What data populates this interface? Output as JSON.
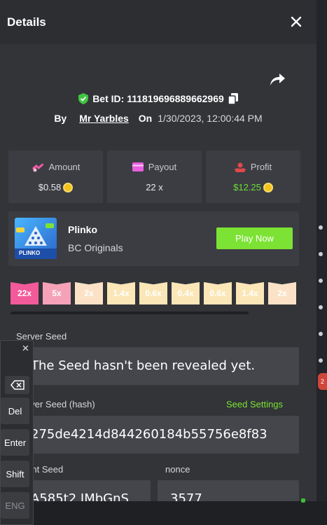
{
  "modal": {
    "title": "Details",
    "bet_id": "Bet ID: 111819696889662969",
    "by_label": "By",
    "username": "Mr Yarbles",
    "on_label": "On",
    "datetime": "1/30/2023, 12:00:44 PM"
  },
  "stats": [
    {
      "label": "Amount",
      "value": "$0.58",
      "icon": "money-icon"
    },
    {
      "label": "Payout",
      "value": "22 x",
      "icon": "card-icon"
    },
    {
      "label": "Profit",
      "value": "$12.25",
      "icon": "profit-icon"
    }
  ],
  "game": {
    "name": "Plinko",
    "provider": "BC Originals",
    "play_label": "Play Now",
    "thumb_text": "PLINKO"
  },
  "multipliers": [
    {
      "label": "22x",
      "color": "#f25a9a"
    },
    {
      "label": "5x",
      "color": "#f5a1b8"
    },
    {
      "label": "2x",
      "color": "#fbe2c6"
    },
    {
      "label": "1.4x",
      "color": "#fbe6b7"
    },
    {
      "label": "0.6x",
      "color": "#fbe6b7"
    },
    {
      "label": "0.4x",
      "color": "#fbe6b7"
    },
    {
      "label": "0.6x",
      "color": "#fbe6b7"
    },
    {
      "label": "1.4x",
      "color": "#fbe6b7"
    },
    {
      "label": "2x",
      "color": "#fbe2c6"
    },
    {
      "label": "5x",
      "color": "#f5a1b8"
    }
  ],
  "fields": {
    "server_seed_label": "Server Seed",
    "server_seed_value": "The Seed hasn't been revealed yet.",
    "server_seed_hash_label": "Server Seed (hash)",
    "seed_settings": "Seed Settings",
    "server_seed_hash_value": "275de4214d844260184b55756e8f83",
    "client_seed_label": "Client Seed",
    "client_seed_value": "A585t2 JMbGnS",
    "nonce_label": "nonce",
    "nonce_value": "3577"
  },
  "keyboard": {
    "keys": [
      "Del",
      "Enter",
      "Shift",
      "ENG"
    ]
  },
  "background": {
    "badge": "2"
  },
  "colors": {
    "accent_green": "#7ce334",
    "profit_green": "#6ede36",
    "coin": "#f3c21b"
  }
}
